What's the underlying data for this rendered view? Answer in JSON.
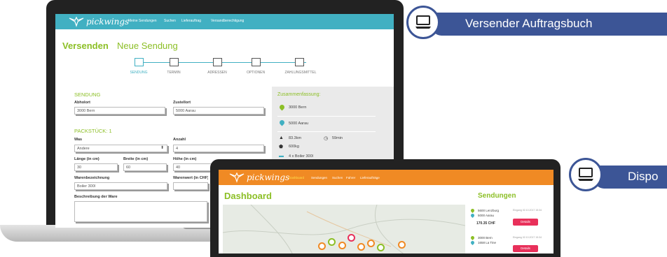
{
  "colors": {
    "teal": "#41b0c2",
    "green": "#8cbf26",
    "orange": "#f08a24",
    "navy": "#3c5596",
    "pink": "#e8305a"
  },
  "laptop1": {
    "logo": "pickwings",
    "nav": [
      "Meine Sendungen",
      "Suchen",
      "Lieferauftrag",
      "Versandberechtigung"
    ],
    "title": "Versenden",
    "subtitle": "Neue Sendung",
    "steps": [
      "SENDUNG",
      "TERMIN",
      "ADRESSEN",
      "OPTIONEN",
      "ZAHLUNGSMITTEL"
    ],
    "sendung": {
      "title": "SENDUNG",
      "abholort_label": "Abholort",
      "abholort_value": "3000 Bern",
      "zustellort_label": "Zustellort",
      "zustellort_value": "5000 Aarau"
    },
    "packstueck": {
      "title": "PACKSTÜCK: 1",
      "was_label": "Was",
      "was_value": "Andere",
      "anzahl_label": "Anzahl",
      "anzahl_value": "4",
      "laenge_label": "Länge (in cm)",
      "laenge_value": "30",
      "breite_label": "Breite (in cm)",
      "breite_value": "60",
      "hoehe_label": "Höhe (in cm)",
      "hoehe_value": "40",
      "warenbez_label": "Warenbezeichnung",
      "warenbez_value": "Boiler 300l",
      "warenwert_label": "Warenwert (in CHF)",
      "beschreibung_label": "Beschreibung der Ware"
    },
    "summary": {
      "title": "Zusammenfassung:",
      "from": "3000 Bern",
      "to": "5000 Aarau",
      "distance": "83.3km",
      "duration": "59min",
      "weight": "600kg",
      "items": "4 x Boiler 300l"
    }
  },
  "laptop2": {
    "logo": "pickwings",
    "nav": [
      "Dashboard",
      "Sendungen",
      "Suchen",
      "Fahrer",
      "Lieferaufträge"
    ],
    "title": "Dashboard",
    "sendungen_title": "Sendungen",
    "shipments": [
      {
        "from": "5600 Lenzburg",
        "to": "5000 Aarau",
        "date": "Eingang 02.10.2017 15:34",
        "price": "170.35 CHF",
        "details": "Details"
      },
      {
        "from": "3000 Bern",
        "to": "1658 La Tine",
        "date": "Eingang 02.10.2017 15:34",
        "details": "Details"
      }
    ]
  },
  "badges": {
    "shipper": "Versender Auftragsbuch",
    "dispo": "Dispo"
  }
}
